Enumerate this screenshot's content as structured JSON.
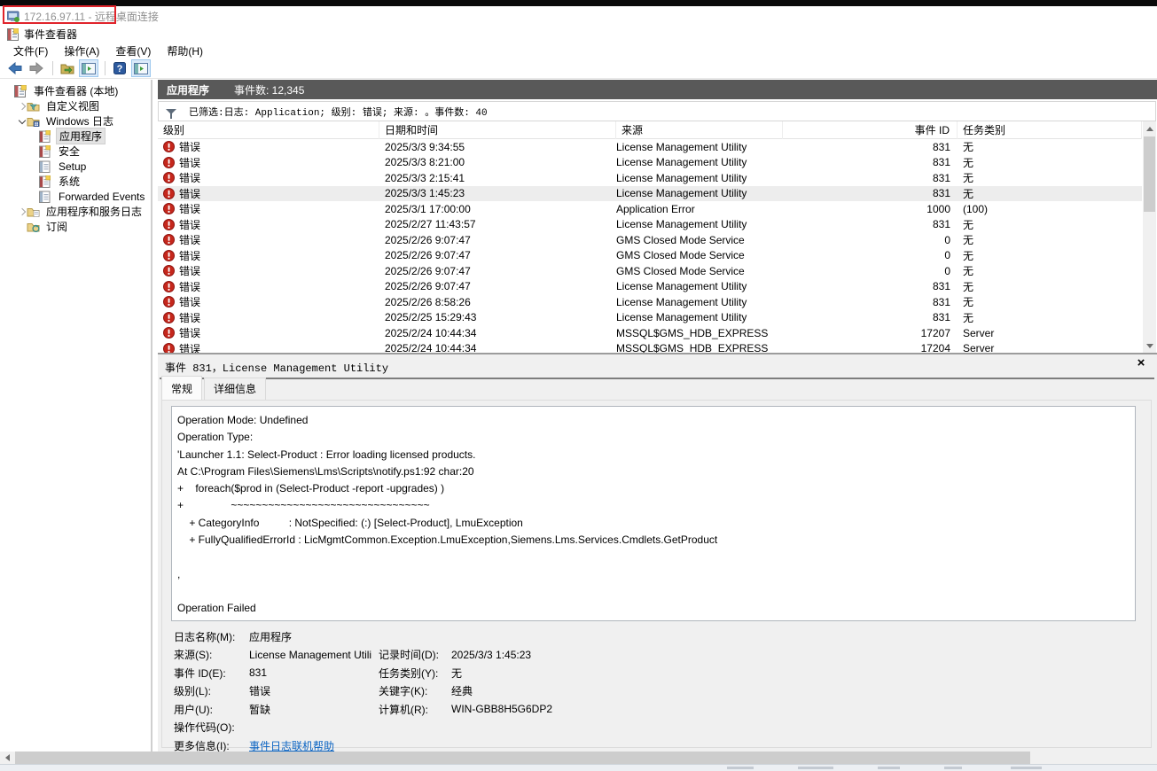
{
  "colors": {
    "dark_header": "#595959",
    "error_red": "#c22a1f",
    "annotation_red": "#e0242b",
    "link_blue": "#0a63c2",
    "selection_gray": "#ededed"
  },
  "rdp_bar": {
    "title": "172.16.97.11 - 远程桌面连接"
  },
  "window": {
    "title": "事件查看器"
  },
  "menu": {
    "items": [
      "文件(F)",
      "操作(A)",
      "查看(V)",
      "帮助(H)"
    ]
  },
  "toolbar": {
    "icons": [
      "back-arrow-icon",
      "forward-arrow-icon",
      "separator",
      "export-folder-icon",
      "show-console-tree-icon",
      "separator",
      "help-icon",
      "show-action-pane-icon"
    ]
  },
  "sidebar": {
    "items": [
      {
        "name": "event-viewer-local",
        "label": "事件查看器 (本地)",
        "depth": 0,
        "icon": "event-viewer-icon",
        "chevron": "none",
        "selected": false
      },
      {
        "name": "custom-views",
        "label": "自定义视图",
        "depth": 1,
        "icon": "custom-views-folder-icon",
        "chevron": "collapsed",
        "selected": false
      },
      {
        "name": "windows-logs",
        "label": "Windows 日志",
        "depth": 1,
        "icon": "windows-logs-folder-icon",
        "chevron": "expanded",
        "selected": false
      },
      {
        "name": "application-log",
        "label": "应用程序",
        "depth": 2,
        "icon": "event-log-icon",
        "chevron": "none",
        "selected": true
      },
      {
        "name": "security-log",
        "label": "安全",
        "depth": 2,
        "icon": "event-log-icon",
        "chevron": "none",
        "selected": false
      },
      {
        "name": "setup-log",
        "label": "Setup",
        "depth": 2,
        "icon": "plain-log-icon",
        "chevron": "none",
        "selected": false
      },
      {
        "name": "system-log",
        "label": "系统",
        "depth": 2,
        "icon": "event-log-icon",
        "chevron": "none",
        "selected": false
      },
      {
        "name": "forwarded-events-log",
        "label": "Forwarded Events",
        "depth": 2,
        "icon": "plain-log-icon",
        "chevron": "none",
        "selected": false
      },
      {
        "name": "apps-services-logs",
        "label": "应用程序和服务日志",
        "depth": 1,
        "icon": "services-logs-folder-icon",
        "chevron": "collapsed",
        "selected": false
      },
      {
        "name": "subscriptions",
        "label": "订阅",
        "depth": 1,
        "icon": "subscriptions-folder-icon",
        "chevron": "none",
        "selected": false
      }
    ]
  },
  "main": {
    "log_title": "应用程序",
    "event_count": "事件数: 12,345",
    "filter_text": "已筛选:日志: Application; 级别: 错误; 来源: 。事件数: 40",
    "columns": [
      "级别",
      "日期和时间",
      "来源",
      "事件 ID",
      "任务类别"
    ],
    "rows": [
      {
        "level": "错误",
        "datetime": "2025/3/3 9:34:55",
        "source": "License Management Utility",
        "id": "831",
        "category": "无",
        "selected": false
      },
      {
        "level": "错误",
        "datetime": "2025/3/3 8:21:00",
        "source": "License Management Utility",
        "id": "831",
        "category": "无",
        "selected": false
      },
      {
        "level": "错误",
        "datetime": "2025/3/3 2:15:41",
        "source": "License Management Utility",
        "id": "831",
        "category": "无",
        "selected": false
      },
      {
        "level": "错误",
        "datetime": "2025/3/3 1:45:23",
        "source": "License Management Utility",
        "id": "831",
        "category": "无",
        "selected": true
      },
      {
        "level": "错误",
        "datetime": "2025/3/1 17:00:00",
        "source": "Application Error",
        "id": "1000",
        "category": "(100)",
        "selected": false
      },
      {
        "level": "错误",
        "datetime": "2025/2/27 11:43:57",
        "source": "License Management Utility",
        "id": "831",
        "category": "无",
        "selected": false
      },
      {
        "level": "错误",
        "datetime": "2025/2/26 9:07:47",
        "source": "GMS Closed Mode Service",
        "id": "0",
        "category": "无",
        "selected": false
      },
      {
        "level": "错误",
        "datetime": "2025/2/26 9:07:47",
        "source": "GMS Closed Mode Service",
        "id": "0",
        "category": "无",
        "selected": false
      },
      {
        "level": "错误",
        "datetime": "2025/2/26 9:07:47",
        "source": "GMS Closed Mode Service",
        "id": "0",
        "category": "无",
        "selected": false
      },
      {
        "level": "错误",
        "datetime": "2025/2/26 9:07:47",
        "source": "License Management Utility",
        "id": "831",
        "category": "无",
        "selected": false
      },
      {
        "level": "错误",
        "datetime": "2025/2/26 8:58:26",
        "source": "License Management Utility",
        "id": "831",
        "category": "无",
        "selected": false
      },
      {
        "level": "错误",
        "datetime": "2025/2/25 15:29:43",
        "source": "License Management Utility",
        "id": "831",
        "category": "无",
        "selected": false
      },
      {
        "level": "错误",
        "datetime": "2025/2/24 10:44:34",
        "source": "MSSQL$GMS_HDB_EXPRESS",
        "id": "17207",
        "category": "Server",
        "selected": false
      },
      {
        "level": "错误",
        "datetime": "2025/2/24 10:44:34",
        "source": "MSSQL$GMS_HDB_EXPRESS",
        "id": "17204",
        "category": "Server",
        "selected": false
      }
    ]
  },
  "detail": {
    "header": "事件 831，License Management Utility",
    "close_label": "×",
    "tabs": [
      {
        "label": "常规",
        "active": true
      },
      {
        "label": "详细信息",
        "active": false
      }
    ],
    "message_lines": [
      "Operation Mode: Undefined",
      "Operation Type:",
      "'Launcher 1.1: Select-Product : Error loading licensed products.",
      "At C:\\Program Files\\Siemens\\Lms\\Scripts\\notify.ps1:92 char:20",
      "+    foreach($prod in (Select-Product -report -upgrades) )",
      "+                ~~~~~~~~~~~~~~~~~~~~~~~~~~~~~~~~",
      "    + CategoryInfo          : NotSpecified: (:) [Select-Product], LmuException",
      "    + FullyQualifiedErrorId : LicMgmtCommon.Exception.LmuException,Siemens.Lms.Services.Cmdlets.GetProduct",
      "",
      ",",
      "",
      "Operation Failed"
    ],
    "fields": [
      {
        "label": "日志名称(M):",
        "value": "应用程序"
      },
      {
        "label": "来源(S):",
        "value": "License Management Utili",
        "label2": "记录时间(D):",
        "value2": "2025/3/3 1:45:23"
      },
      {
        "label": "事件 ID(E):",
        "value": "831",
        "label2": "任务类别(Y):",
        "value2": "无"
      },
      {
        "label": "级别(L):",
        "value": "错误",
        "label2": "关键字(K):",
        "value2": "经典"
      },
      {
        "label": "用户(U):",
        "value": "暂缺",
        "label2": "计算机(R):",
        "value2": "WIN-GBB8H5G6DP2"
      },
      {
        "label": "操作代码(O):",
        "value": ""
      },
      {
        "label": "更多信息(I):",
        "value": "事件日志联机帮助",
        "link": true
      }
    ]
  }
}
